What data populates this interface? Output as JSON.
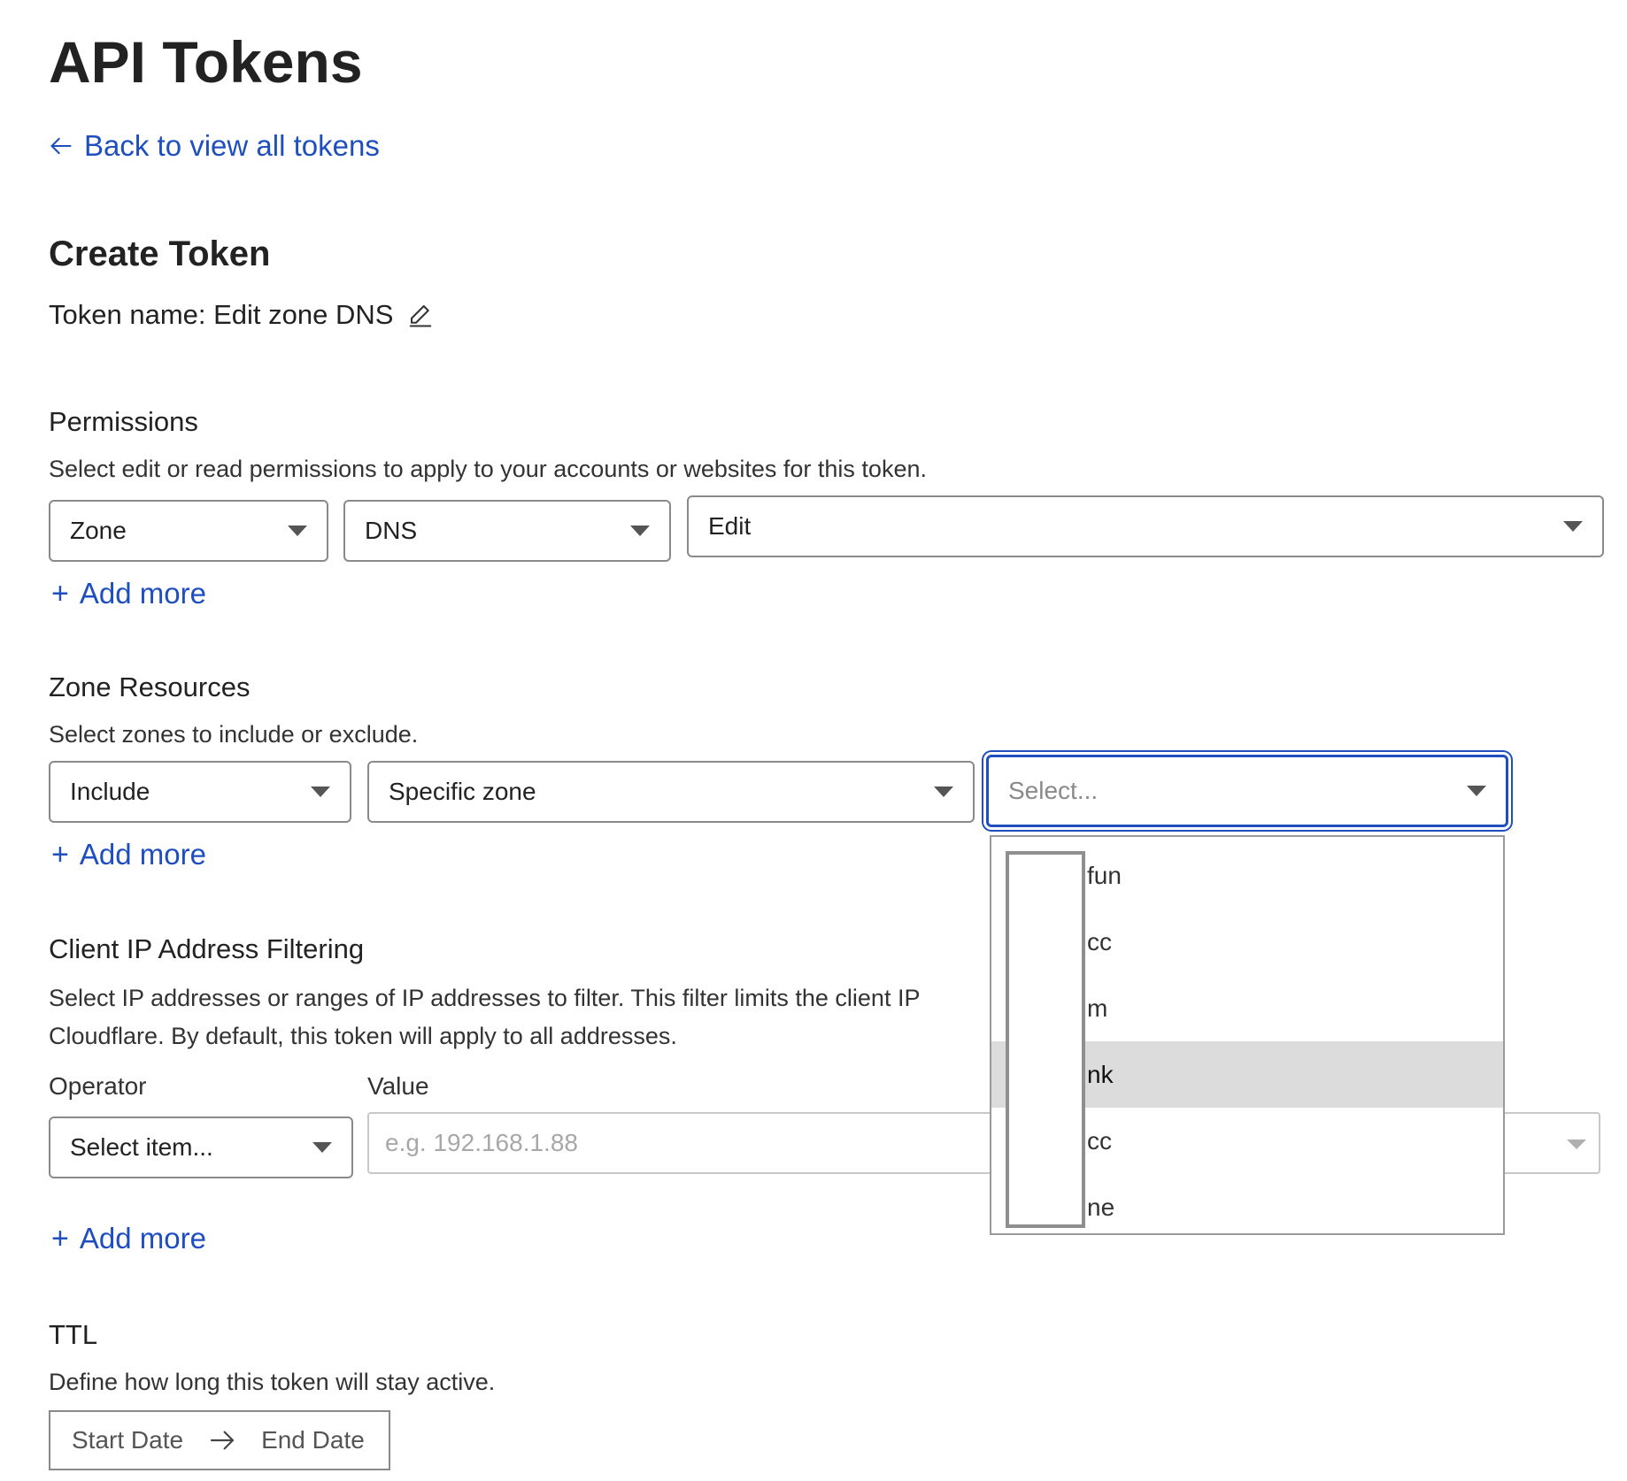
{
  "page": {
    "title": "API Tokens",
    "back_link": "Back to view all tokens"
  },
  "create": {
    "heading": "Create Token",
    "token_name": "Token name: Edit zone DNS"
  },
  "permissions": {
    "heading": "Permissions",
    "description": "Select edit or read permissions to apply to your accounts or websites for this token.",
    "scope": "Zone",
    "resource": "DNS",
    "level": "Edit",
    "add_more": "Add more"
  },
  "zone_resources": {
    "heading": "Zone Resources",
    "description": "Select zones to include or exclude.",
    "mode": "Include",
    "target": "Specific zone",
    "zone_select_placeholder": "Select...",
    "add_more": "Add more",
    "dropdown_options": [
      "fun",
      "cc",
      "m",
      "nk",
      "cc",
      "ne"
    ],
    "highlighted_index": 3
  },
  "ip_filter": {
    "heading": "Client IP Address Filtering",
    "description_line1": "Select IP addresses or ranges of IP addresses to filter. This filter limits the client IP",
    "description_line2": "Cloudflare. By default, this token will apply to all addresses.",
    "operator_label": "Operator",
    "value_label": "Value",
    "operator_placeholder": "Select item...",
    "value_placeholder": "e.g. 192.168.1.88",
    "add_more": "Add more"
  },
  "ttl": {
    "heading": "TTL",
    "description": "Define how long this token will stay active.",
    "start": "Start Date",
    "end": "End Date"
  },
  "colors": {
    "link": "#1f4fbf",
    "focus": "#1f4fbf",
    "highlight": "#dcdcdc"
  }
}
